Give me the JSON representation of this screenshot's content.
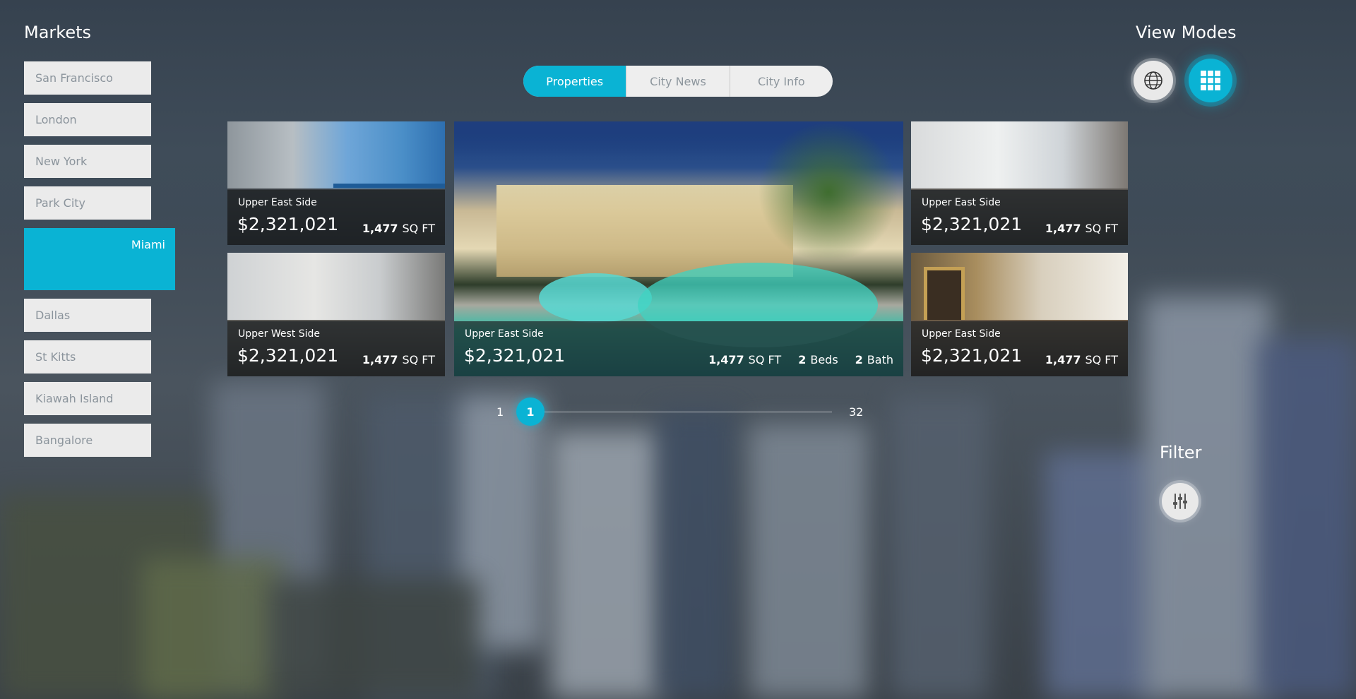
{
  "markets": {
    "title": "Markets",
    "items": [
      {
        "label": "San Francisco",
        "active": false
      },
      {
        "label": "London",
        "active": false
      },
      {
        "label": "New York",
        "active": false
      },
      {
        "label": "Park City",
        "active": false
      },
      {
        "label": "Miami",
        "active": true
      },
      {
        "label": "Dallas",
        "active": false
      },
      {
        "label": "St Kitts",
        "active": false
      },
      {
        "label": "Kiawah Island",
        "active": false
      },
      {
        "label": "Bangalore",
        "active": false
      }
    ]
  },
  "tabs": [
    {
      "label": "Properties",
      "active": true
    },
    {
      "label": "City News",
      "active": false
    },
    {
      "label": "City Info",
      "active": false
    }
  ],
  "view_modes": {
    "title": "View Modes",
    "options": [
      {
        "icon": "globe-icon",
        "active": false
      },
      {
        "icon": "grid-icon",
        "active": true
      }
    ]
  },
  "listings": [
    {
      "location": "Upper East Side",
      "price": "$2,321,021",
      "sqft": "1,477",
      "sqft_unit": "SQ FT"
    },
    {
      "location": "Upper West Side",
      "price": "$2,321,021",
      "sqft": "1,477",
      "sqft_unit": "SQ FT"
    },
    {
      "location": "Upper East Side",
      "price": "$2,321,021",
      "sqft": "1,477",
      "sqft_unit": "SQ FT",
      "beds": "2",
      "beds_label": "Beds",
      "baths": "2",
      "baths_label": "Bath"
    },
    {
      "location": "Upper East Side",
      "price": "$2,321,021",
      "sqft": "1,477",
      "sqft_unit": "SQ FT"
    },
    {
      "location": "Upper East Side",
      "price": "$2,321,021",
      "sqft": "1,477",
      "sqft_unit": "SQ FT"
    }
  ],
  "pagination": {
    "min": "1",
    "current": "1",
    "max": "32"
  },
  "filter": {
    "title": "Filter",
    "icon": "sliders-icon"
  },
  "colors": {
    "accent": "#0ab3d4",
    "button_bg": "#ebebeb",
    "button_text": "#8b949c"
  }
}
